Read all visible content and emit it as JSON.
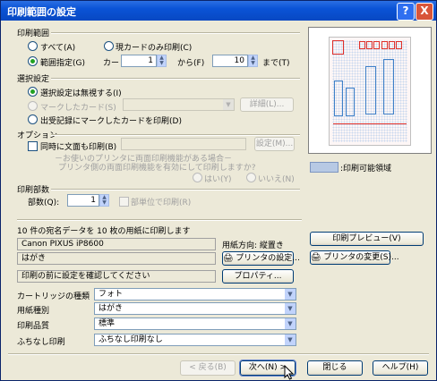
{
  "window": {
    "title": "印刷範囲の設定",
    "help_glyph": "?",
    "close_glyph": "X"
  },
  "print_range": {
    "heading": "印刷範囲",
    "all": "すべて(A)",
    "current_card_only": "現カードのみ印刷(C)",
    "range_spec": "範囲指定(G)",
    "card_label": "カード",
    "from_value": "1",
    "from_label": "から(F)",
    "to_value": "10",
    "to_label": "まで(T)"
  },
  "selection": {
    "heading": "選択設定",
    "ignore": "選択設定は無視する(I)",
    "marked_card": "マークしたカード(S)",
    "details_button": "詳細(L)...",
    "history_marked": "出受記録にマークしたカードを印刷(D)"
  },
  "options": {
    "heading": "オプション",
    "duplex_label": "同時に文面も印刷(B)",
    "settings_button": "設定(M)...",
    "note_line1": "－お使いのプリンタに両面印刷機能がある場合－",
    "note_line2": "プリンタ側の両面印刷機能を有効にして印刷しますか?",
    "yes": "はい(Y)",
    "no": "いいえ(N)"
  },
  "copies": {
    "heading": "印刷部数",
    "label": "部数(Q):",
    "value": "1",
    "collate": "部単位で印刷(R)"
  },
  "summary": "10 件の宛名データを 10 枚の用紙に印刷します",
  "printer": {
    "name": "Canon PIXUS iP8600",
    "paper": "はがき",
    "confirm": "印刷の前に設定を確認してください",
    "orientation": "用紙方向: 縦置き",
    "printer_settings_button": "プリンタの設定...",
    "properties_button": "プロパティ...",
    "preview_button": "印刷プレビュー(V)",
    "change_printer_button": "プリンタの変更(S)..."
  },
  "settings": [
    {
      "label": "カートリッジの種類",
      "value": "フォト"
    },
    {
      "label": "用紙種別",
      "value": "はがき"
    },
    {
      "label": "印刷品質",
      "value": "標準"
    },
    {
      "label": "ふちなし印刷",
      "value": "ふちなし印刷なし"
    }
  ],
  "legend": {
    "printable_area": ":印刷可能領域"
  },
  "footer": {
    "back": "< 戻る(B)",
    "next": "次へ(N) >",
    "close": "閉じる",
    "help": "ヘルプ(H)"
  },
  "colors": {
    "accent": "#0a53d6",
    "preview_red": "#e0302a",
    "preview_blue": "#3e80c8"
  }
}
